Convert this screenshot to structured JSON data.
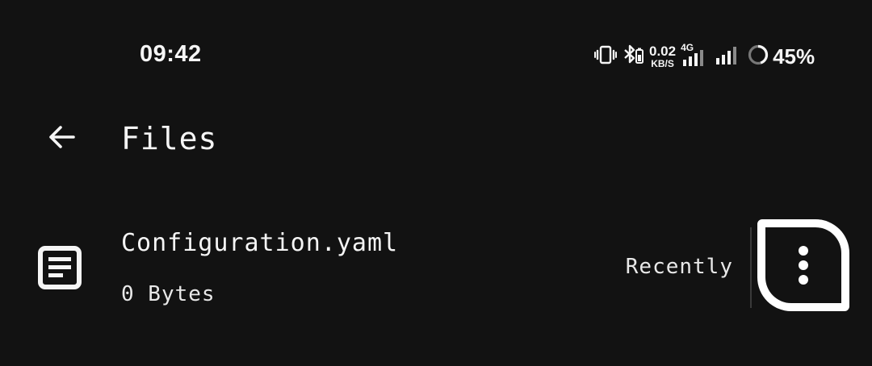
{
  "status_bar": {
    "time": "09:42",
    "net_speed_value": "0.02",
    "net_speed_unit": "KB/S",
    "network_type": "4G",
    "battery_percent": "45%",
    "icons": [
      "vibrate-icon",
      "bluetooth-icon",
      "signal-4g-icon",
      "signal-icon",
      "battery-ring-icon"
    ]
  },
  "app_bar": {
    "back_icon": "arrow-back-icon",
    "title": "Files"
  },
  "files": [
    {
      "icon": "document-icon",
      "name": "Configuration.yaml",
      "size": "0 Bytes",
      "modified": "Recently",
      "menu_icon": "more-vertical-icon"
    }
  ]
}
